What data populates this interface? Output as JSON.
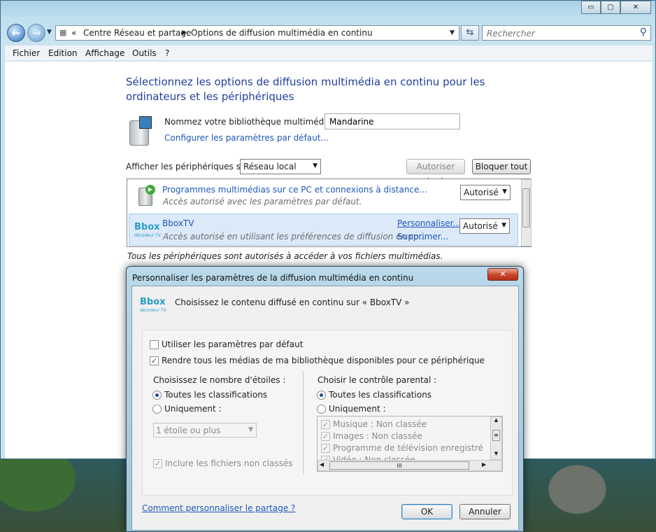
{
  "window": {
    "caption_buttons": {
      "minimize": "▭",
      "maximize": "▢",
      "close": "✕"
    },
    "address": {
      "crumb1": "Centre Réseau et partage",
      "crumb2": "Options de diffusion multimédia en continu",
      "prefix": "«"
    },
    "search": {
      "placeholder": "Rechercher"
    }
  },
  "menu": [
    "Fichier",
    "Edition",
    "Affichage",
    "Outils",
    "?"
  ],
  "main": {
    "heading": "Sélectionnez les options de diffusion multimédia en continu pour les ordinateurs et les périphériques",
    "library_label": "Nommez votre bibliothèque multimédia :",
    "library_value": "Mandarine",
    "configure_link": "Configurer les paramètres par défaut...",
    "show_devices_label": "Afficher les périphériques sur :",
    "show_devices_value": "Réseau local",
    "allow_all": "Autoriser tout",
    "block_all": "Bloquer tout",
    "devices": [
      {
        "name": "Programmes multimédias sur ce PC et connexions à distance...",
        "desc": "Accès autorisé avec les paramètres par défaut.",
        "status": "Autorisé",
        "customize": "",
        "remove": ""
      },
      {
        "name": "BboxTV",
        "desc": "Accès autorisé en utilisant les préférences de diffusion en co...",
        "status": "Autorisé",
        "customize": "Personnaliser...",
        "remove": "Supprimer..."
      }
    ],
    "footer_note": "Tous les périphériques sont autorisés à accéder à vos fichiers multimédias."
  },
  "dialog": {
    "title": "Personnaliser les paramètres de la diffusion multimédia en continu",
    "close": "✕",
    "subtitle": "Choisissez le contenu diffusé en continu sur « BboxTV »",
    "logo_main": "Bbox",
    "logo_sub": "décodeur TV",
    "use_defaults": "Utiliser les paramètres par défaut",
    "make_all_available": "Rendre tous les médias de ma bibliothèque disponibles pour ce périphérique",
    "stars_label": "Choisissez le nombre d'étoiles :",
    "stars_all": "Toutes les classifications",
    "stars_only": "Uniquement :",
    "stars_select": "1 étoile ou plus",
    "include_unrated": "Inclure les fichiers non classés",
    "parental_label": "Choisir le contrôle parental :",
    "parental_all": "Toutes les classifications",
    "parental_only": "Uniquement :",
    "parental_items": [
      "Musique : Non classée",
      "Images : Non classée",
      "Programme de télévision enregistré : Non cl",
      "Vidéo : Non classée"
    ],
    "help_link": "Comment personnaliser le partage ?",
    "ok": "OK",
    "cancel": "Annuler",
    "hscroll_thumb": "III"
  },
  "colors": {
    "heading": "#1f3f9c",
    "link": "#1c57b8",
    "selection": "#dce9f8"
  }
}
